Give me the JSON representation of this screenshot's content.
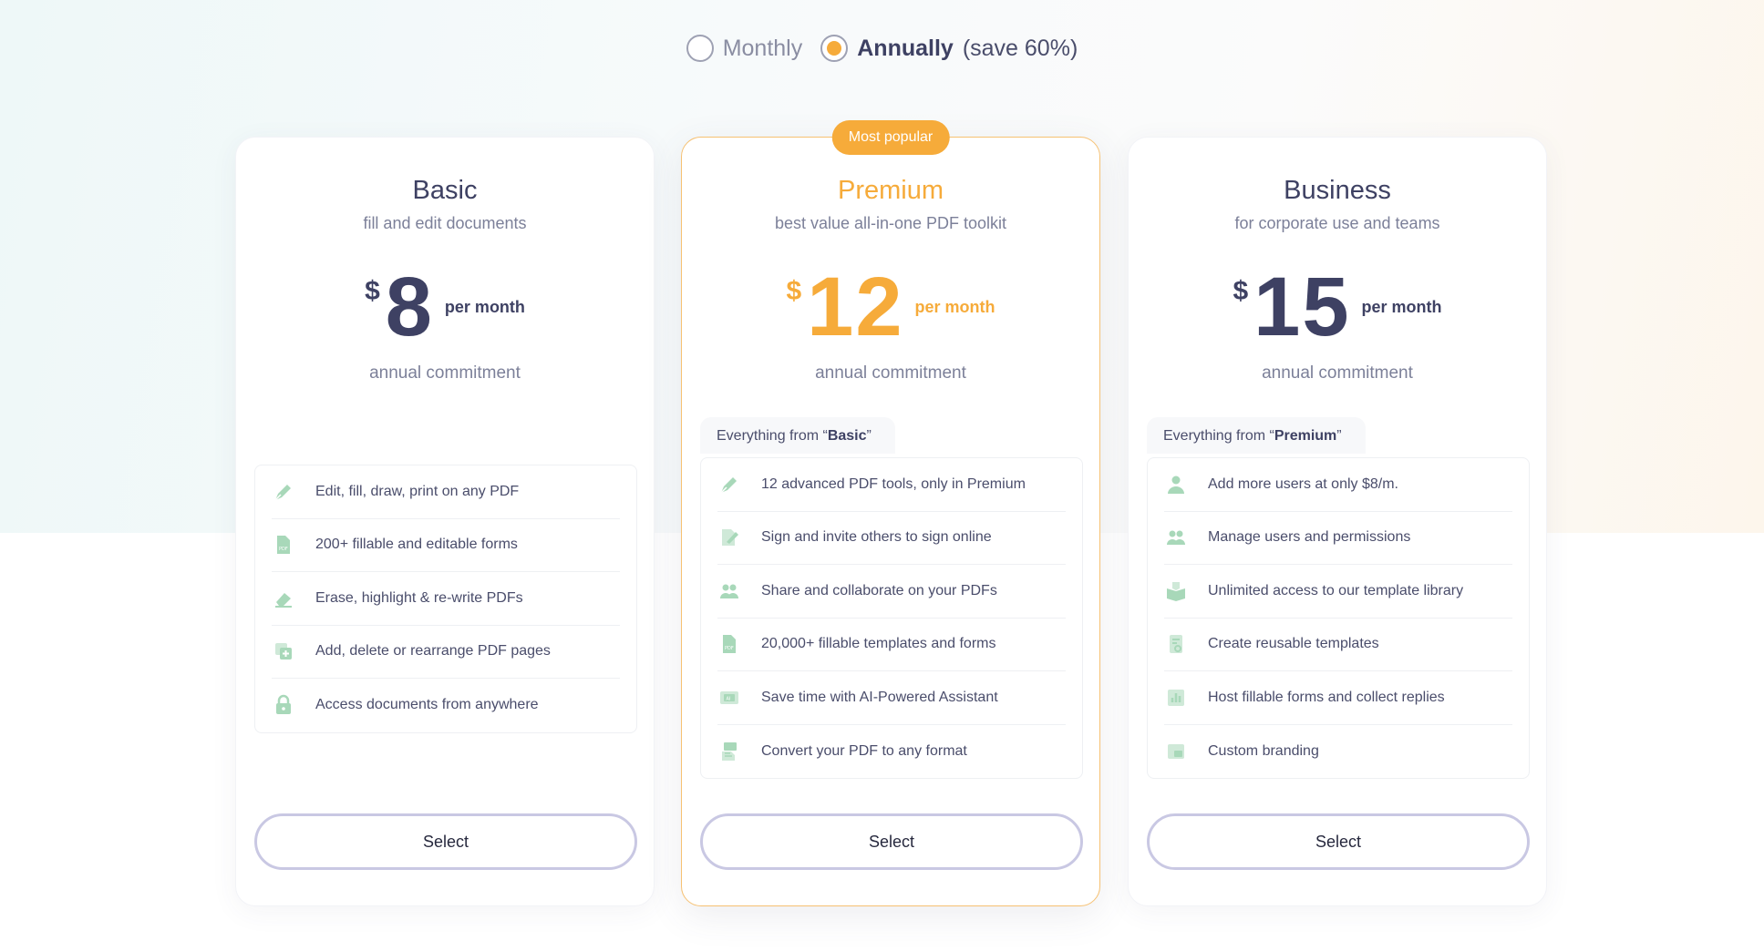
{
  "billing": {
    "options": [
      {
        "label": "Monthly",
        "checked": false
      },
      {
        "label": "Annually",
        "checked": true
      }
    ],
    "save_note": "(save 60%)"
  },
  "colors": {
    "accent": "#f6ab3a",
    "text_dark": "#3e4163",
    "feature_icon": "#a8d8b9",
    "button_border": "#c9c8e3"
  },
  "plans": [
    {
      "name": "Basic",
      "subtitle": "fill and edit documents",
      "currency": "$",
      "price": "8",
      "period": "per month",
      "commitment": "annual commitment",
      "features": [
        {
          "icon": "pen-icon",
          "label": "Edit, fill, draw, print on any PDF"
        },
        {
          "icon": "pdf-form-icon",
          "label": "200+ fillable and editable forms"
        },
        {
          "icon": "eraser-icon",
          "label": "Erase, highlight & re-write PDFs"
        },
        {
          "icon": "add-pages-icon",
          "label": "Add, delete or rearrange PDF pages"
        },
        {
          "icon": "lock-icon",
          "label": "Access documents from anywhere"
        }
      ],
      "button": "Select"
    },
    {
      "name": "Premium",
      "badge": "Most popular",
      "subtitle": "best value all-in-one PDF toolkit",
      "currency": "$",
      "price": "12",
      "period": "per month",
      "commitment": "annual commitment",
      "everything_prefix": "Everything from “",
      "everything_plan": "Basic",
      "everything_suffix": "”",
      "features": [
        {
          "icon": "pen-icon",
          "label": "12 advanced PDF tools, only in Premium"
        },
        {
          "icon": "sign-icon",
          "label": "Sign and invite others to sign online"
        },
        {
          "icon": "users-icon",
          "label": "Share and collaborate on your PDFs"
        },
        {
          "icon": "pdf-form-icon",
          "label": "20,000+ fillable templates and forms"
        },
        {
          "icon": "ai-icon",
          "label": "Save time with AI-Powered Assistant"
        },
        {
          "icon": "convert-icon",
          "label": "Convert your PDF to any format"
        }
      ],
      "button": "Select"
    },
    {
      "name": "Business",
      "subtitle": "for corporate use and teams",
      "currency": "$",
      "price": "15",
      "period": "per month",
      "commitment": "annual commitment",
      "everything_prefix": "Everything from “",
      "everything_plan": "Premium",
      "everything_suffix": "”",
      "features": [
        {
          "icon": "user-icon",
          "label": "Add more users at only $8/m."
        },
        {
          "icon": "users-icon",
          "label": "Manage users and permissions"
        },
        {
          "icon": "template-library-icon",
          "label": "Unlimited access to our template library"
        },
        {
          "icon": "reusable-template-icon",
          "label": "Create reusable templates"
        },
        {
          "icon": "chart-form-icon",
          "label": "Host fillable forms and collect replies"
        },
        {
          "icon": "branding-icon",
          "label": "Custom branding"
        }
      ],
      "button": "Select"
    }
  ]
}
